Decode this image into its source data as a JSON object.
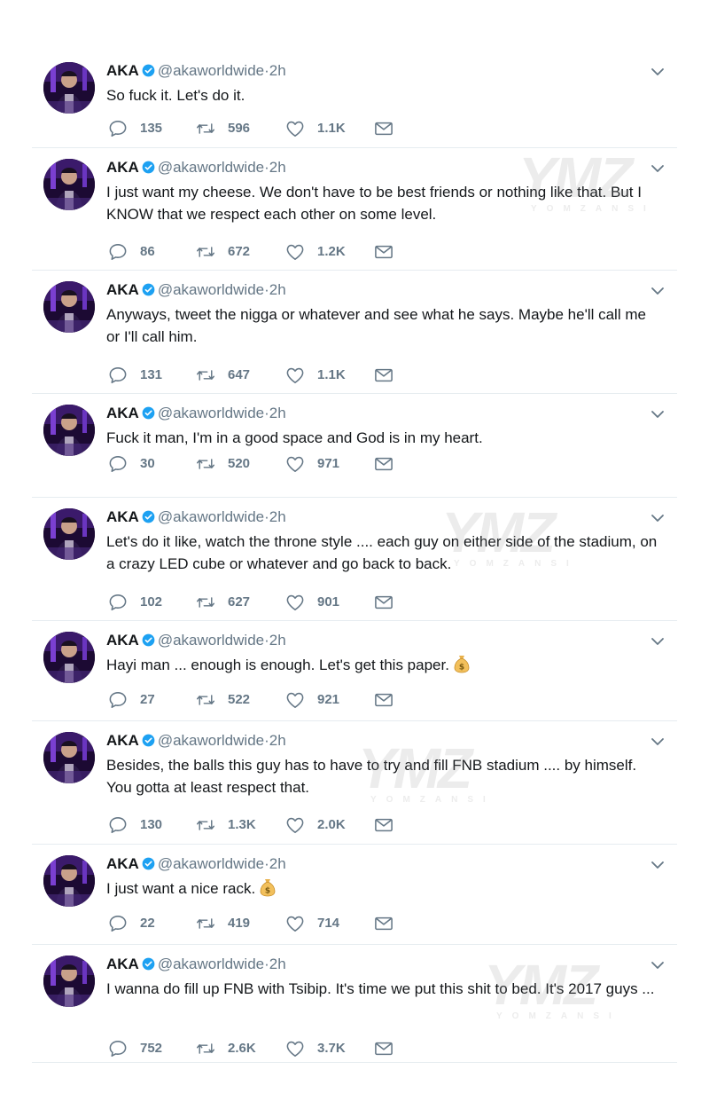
{
  "colors": {
    "verified": "#1da1f2",
    "secondary": "#657786",
    "divider": "#e6ecf0",
    "avatar_bg": "#1c0a33"
  },
  "watermark": {
    "brand": "YMZ",
    "sub": "YOMZANSI"
  },
  "tweets": [
    {
      "name": "AKA",
      "handle": "@akaworldwide",
      "dot": "·",
      "time": "2h",
      "text": "So fuck it. Let's do it.",
      "emoji": "",
      "replies": "135",
      "retweets": "596",
      "likes": "1.1K"
    },
    {
      "name": "AKA",
      "handle": "@akaworldwide",
      "dot": "·",
      "time": "2h",
      "text": "I just want my cheese. We don't have to be best friends or nothing like that. But I KNOW that we respect each other on some level.",
      "emoji": "",
      "replies": "86",
      "retweets": "672",
      "likes": "1.2K"
    },
    {
      "name": "AKA",
      "handle": "@akaworldwide",
      "dot": "·",
      "time": "2h",
      "text": "Anyways, tweet the nigga or whatever and see what he says. Maybe he'll call me or I'll call him.",
      "emoji": "",
      "replies": "131",
      "retweets": "647",
      "likes": "1.1K"
    },
    {
      "name": "AKA",
      "handle": "@akaworldwide",
      "dot": "·",
      "time": "2h",
      "text": "Fuck it man, I'm in a good space and God is in my heart.",
      "emoji": "",
      "replies": "30",
      "retweets": "520",
      "likes": "971"
    },
    {
      "name": "AKA",
      "handle": "@akaworldwide",
      "dot": "·",
      "time": "2h",
      "text": "Let's do it like, watch the throne style .... each guy on either side of the stadium, on a crazy LED cube or whatever and go back to back.",
      "emoji": "",
      "replies": "102",
      "retweets": "627",
      "likes": "901"
    },
    {
      "name": "AKA",
      "handle": "@akaworldwide",
      "dot": "·",
      "time": "2h",
      "text": "Hayi man ... enough is enough. Let's get this paper.",
      "emoji": "money-bag",
      "replies": "27",
      "retweets": "522",
      "likes": "921"
    },
    {
      "name": "AKA",
      "handle": "@akaworldwide",
      "dot": "·",
      "time": "2h",
      "text": "Besides, the balls this guy has to have to try and fill FNB stadium .... by himself. You gotta at least respect that.",
      "emoji": "",
      "replies": "130",
      "retweets": "1.3K",
      "likes": "2.0K"
    },
    {
      "name": "AKA",
      "handle": "@akaworldwide",
      "dot": "·",
      "time": "2h",
      "text": "I just want a nice rack.",
      "emoji": "money-bag",
      "replies": "22",
      "retweets": "419",
      "likes": "714"
    },
    {
      "name": "AKA",
      "handle": "@akaworldwide",
      "dot": "·",
      "time": "2h",
      "text": "I wanna do fill up FNB with Tsibip. It's time we put this shit to bed. It's 2017 guys ...",
      "emoji": "",
      "replies": "752",
      "retweets": "2.6K",
      "likes": "3.7K"
    }
  ]
}
